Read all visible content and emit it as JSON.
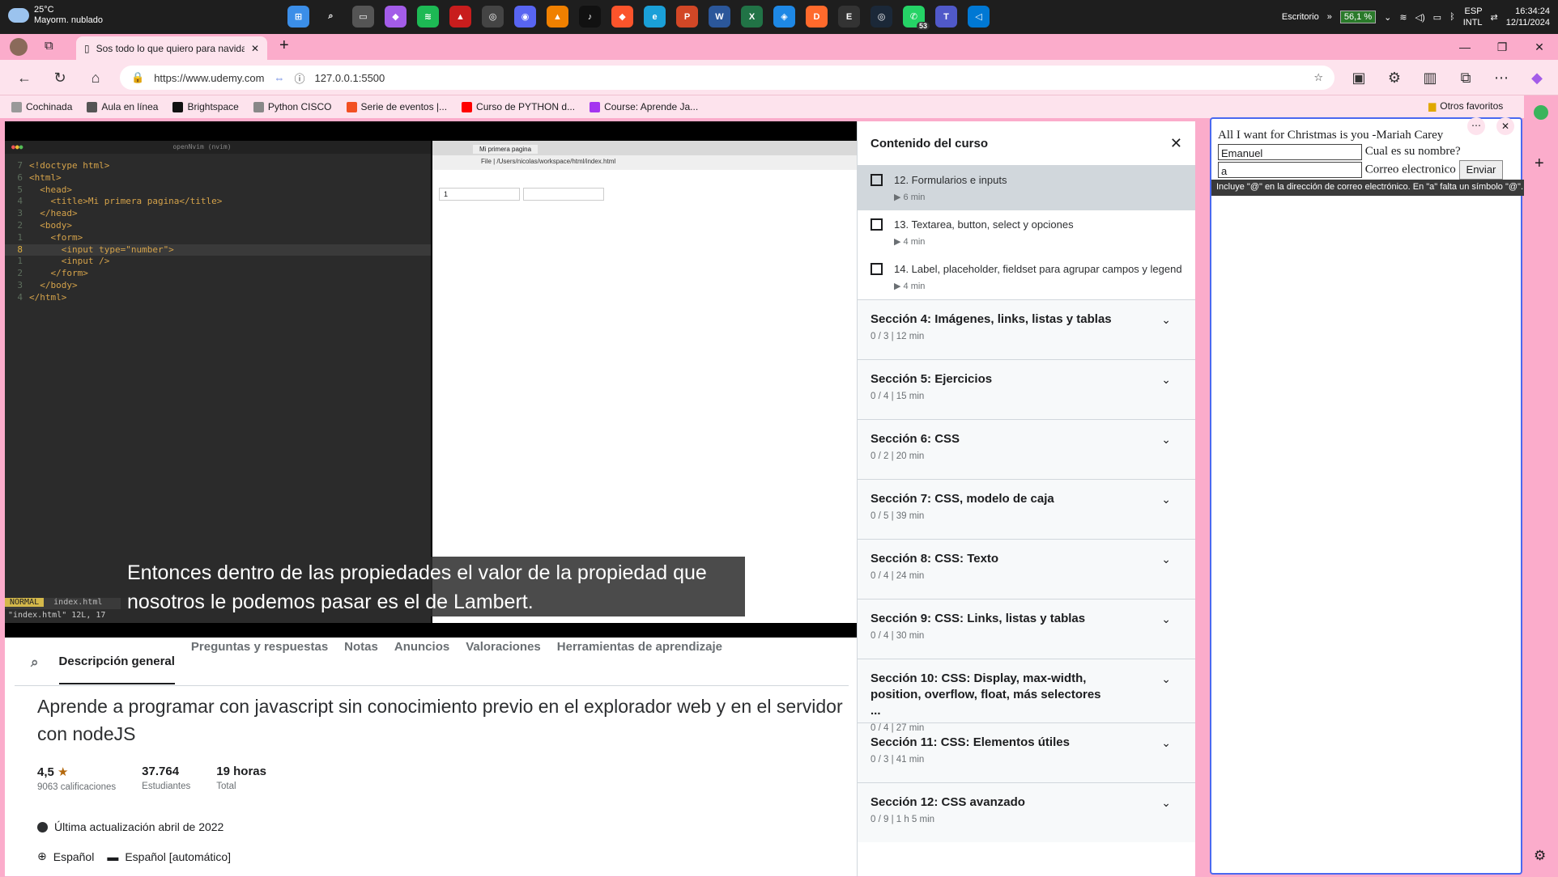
{
  "taskbar": {
    "weather_temp": "25°C",
    "weather_desc": "Mayorm. nublado",
    "desktop_label": "Escritorio",
    "battery": "56,1 %",
    "lang1": "ESP",
    "lang2": "INTL",
    "time": "16:34:24",
    "date": "12/11/2024",
    "whatsapp_badge": "53",
    "apps": [
      {
        "name": "windows-start-icon",
        "color": "#3b8ee8",
        "glyph": "⊞"
      },
      {
        "name": "search-icon",
        "color": "#1e1e1e",
        "glyph": "⌕"
      },
      {
        "name": "task-view-icon",
        "color": "#555",
        "glyph": "▭"
      },
      {
        "name": "copilot-icon",
        "color": "#a35ce8",
        "glyph": "◆"
      },
      {
        "name": "spotify-icon",
        "color": "#1db954",
        "glyph": "≋"
      },
      {
        "name": "game-icon",
        "color": "#c81d1d",
        "glyph": "▲"
      },
      {
        "name": "steam-small-icon",
        "color": "#444",
        "glyph": "◎"
      },
      {
        "name": "discord-icon",
        "color": "#5865f2",
        "glyph": "◉"
      },
      {
        "name": "vlc-icon",
        "color": "#f08000",
        "glyph": "▲"
      },
      {
        "name": "tiktok-icon",
        "color": "#111",
        "glyph": "♪"
      },
      {
        "name": "brave-icon",
        "color": "#fb542b",
        "glyph": "◆"
      },
      {
        "name": "edge-icon",
        "color": "#1aa0d8",
        "glyph": "e"
      },
      {
        "name": "powerpoint-icon",
        "color": "#d24726",
        "glyph": "P"
      },
      {
        "name": "word-icon",
        "color": "#2b579a",
        "glyph": "W"
      },
      {
        "name": "excel-icon",
        "color": "#217346",
        "glyph": "X"
      },
      {
        "name": "app-blue-icon",
        "color": "#1e88e5",
        "glyph": "◈"
      },
      {
        "name": "dex-icon",
        "color": "#ff6a2c",
        "glyph": "D"
      },
      {
        "name": "epic-icon",
        "color": "#333",
        "glyph": "E"
      },
      {
        "name": "steam-icon",
        "color": "#1b2838",
        "glyph": "◎"
      },
      {
        "name": "whatsapp-icon",
        "color": "#25d366",
        "glyph": "✆"
      },
      {
        "name": "teams-icon",
        "color": "#5059c9",
        "glyph": "T"
      },
      {
        "name": "vscode-icon",
        "color": "#0078d4",
        "glyph": "◁"
      }
    ]
  },
  "browser": {
    "tab_title": "Sos todo lo que quiero para navidad",
    "url_site": "https://www.udemy.com",
    "url_local": "127.0.0.1:5500",
    "favorites": [
      {
        "label": "Cochinada",
        "color": "#999"
      },
      {
        "label": "Aula en línea",
        "color": "#555"
      },
      {
        "label": "Brightspace",
        "color": "#111"
      },
      {
        "label": "Python CISCO",
        "color": "#888"
      },
      {
        "label": "Serie de eventos |...",
        "color": "#f25022"
      },
      {
        "label": "Curso de PYTHON d...",
        "color": "#ff0000"
      },
      {
        "label": "Course: Aprende Ja...",
        "color": "#a435f0"
      }
    ],
    "other_favorites": "Otros favoritos"
  },
  "video": {
    "editor_title": "openNvim (nvim)",
    "code_lines": [
      {
        "n": "7",
        "t": "<!doctype html>"
      },
      {
        "n": "6",
        "t": "<html>"
      },
      {
        "n": "5",
        "t": "  <head>"
      },
      {
        "n": "4",
        "t": "    <title>Mi primera pagina</title>"
      },
      {
        "n": "3",
        "t": "  </head>"
      },
      {
        "n": "2",
        "t": "  <body>"
      },
      {
        "n": "1",
        "t": "    <form>"
      },
      {
        "n": "8",
        "t": "      <input type=\"number\">"
      },
      {
        "n": "1",
        "t": "      <input />"
      },
      {
        "n": "2",
        "t": "    </form>"
      },
      {
        "n": "3",
        "t": "  </body>"
      },
      {
        "n": "4",
        "t": "</html>"
      }
    ],
    "mode": "NORMAL",
    "status_file": "index.html",
    "status_info": "\"index.html\" 12L, 17",
    "mini_tab": "Mi primera pagina",
    "mini_url": "File | /Users/nicolas/workspace/html/index.html",
    "mini_input_value": "1",
    "subtitle": "Entonces dentro de las propiedades el valor de la propiedad que nosotros le podemos pasar es el de Lambert."
  },
  "course": {
    "tabs": [
      "Descripción general",
      "Preguntas y respuestas",
      "Notas",
      "Anuncios",
      "Valoraciones",
      "Herramientas de aprendizaje"
    ],
    "title": "Aprende a programar con javascript sin conocimiento previo en el explorador web y en el servidor con nodeJS",
    "rating": "4,5",
    "rating_label": "9063 calificaciones",
    "students": "37.764",
    "students_label": "Estudiantes",
    "hours": "19 horas",
    "hours_label": "Total",
    "updated": "Última actualización abril de 2022",
    "language": "Español",
    "captions": "Español [automático]"
  },
  "sidebar": {
    "header": "Contenido del curso",
    "lectures": [
      {
        "title": "12. Formularios e inputs",
        "duration": "6 min"
      },
      {
        "title": "13. Textarea, button, select y opciones",
        "duration": "4 min"
      },
      {
        "title": "14. Label, placeholder, fieldset para agrupar campos y legend",
        "duration": "4 min"
      }
    ],
    "sections": [
      {
        "title": "Sección 4: Imágenes, links, listas y tablas",
        "meta": "0 / 3 | 12 min"
      },
      {
        "title": "Sección 5: Ejercicios",
        "meta": "0 / 4 | 15 min"
      },
      {
        "title": "Sección 6: CSS",
        "meta": "0 / 2 | 20 min"
      },
      {
        "title": "Sección 7: CSS, modelo de caja",
        "meta": "0 / 5 | 39 min"
      },
      {
        "title": "Sección 8: CSS: Texto",
        "meta": "0 / 4 | 24 min"
      },
      {
        "title": "Sección 9: CSS: Links, listas y tablas",
        "meta": "0 / 4 | 30 min"
      },
      {
        "title": "Sección 10: CSS: Display, max-width, position, overflow, float, más selectores ...",
        "meta": "0 / 4 | 27 min"
      },
      {
        "title": "Sección 11: CSS: Elementos útiles",
        "meta": "0 / 3 | 41 min"
      },
      {
        "title": "Sección 12: CSS avanzado",
        "meta": "0 / 9 | 1 h 5 min"
      }
    ]
  },
  "panel": {
    "heading": "All I want for Christmas is you -Mariah Carey",
    "name_value": "Emanuel",
    "name_label": "Cual es su nombre?",
    "email_value": "a",
    "email_label": "Correo electronico",
    "submit": "Enviar",
    "tooltip": "Incluye \"@\" en la dirección de correo electrónico. En \"a\" falta un símbolo \"@\"."
  }
}
